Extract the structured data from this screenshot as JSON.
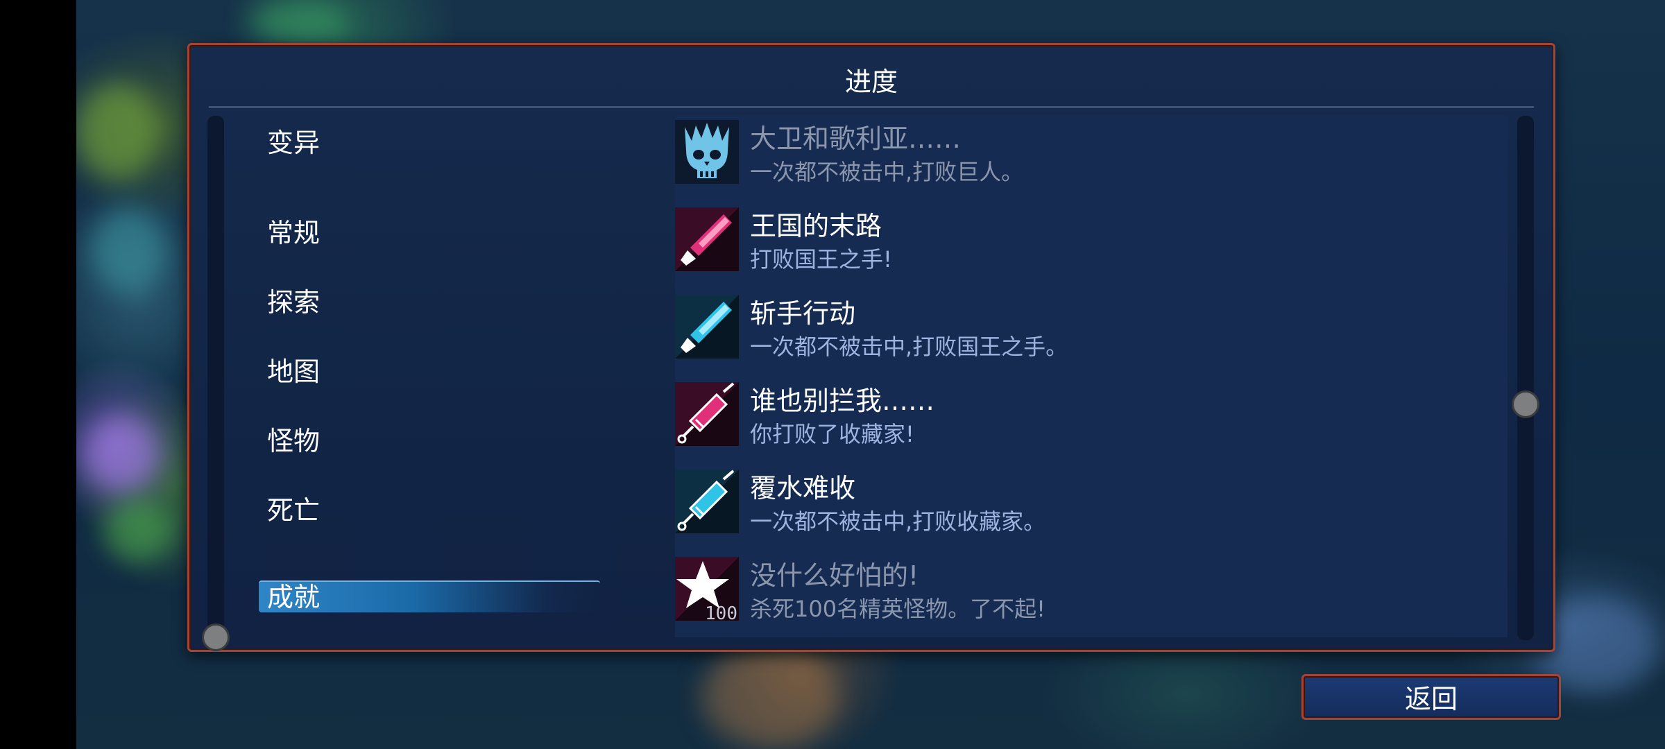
{
  "panel": {
    "title": "进度"
  },
  "nav": {
    "items": [
      {
        "label": "变异",
        "active": false
      },
      {
        "label": "常规",
        "active": false
      },
      {
        "label": "探索",
        "active": false
      },
      {
        "label": "地图",
        "active": false
      },
      {
        "label": "怪物",
        "active": false
      },
      {
        "label": "死亡",
        "active": false
      },
      {
        "label": "成就",
        "active": true
      }
    ]
  },
  "achievements": [
    {
      "title": "大卫和歌利亚……",
      "desc": "一次都不被击中,打败巨人。",
      "icon": "giant-skull-icon",
      "icon_color": "#6fc4e8",
      "dim": true
    },
    {
      "title": "王国的末路",
      "desc": "打败国王之手!",
      "icon": "pink-crystal-icon",
      "icon_color": "#e0307a",
      "dim": false
    },
    {
      "title": "斩手行动",
      "desc": "一次都不被击中,打败国王之手。",
      "icon": "cyan-crystal-icon",
      "icon_color": "#2fc3e8",
      "dim": false
    },
    {
      "title": "谁也别拦我……",
      "desc": "你打败了收藏家!",
      "icon": "pink-syringe-icon",
      "icon_color": "#e0307a",
      "dim": false
    },
    {
      "title": "覆水难收",
      "desc": "一次都不被击中,打败收藏家。",
      "icon": "cyan-syringe-icon",
      "icon_color": "#2fc3e8",
      "dim": false
    },
    {
      "title": "没什么好怕的!",
      "desc": "杀死100名精英怪物。了不起!",
      "icon": "star-100-icon",
      "icon_color": "#e0307a",
      "icon_text": "100",
      "dim": true
    }
  ],
  "back_button": {
    "label": "返回"
  }
}
